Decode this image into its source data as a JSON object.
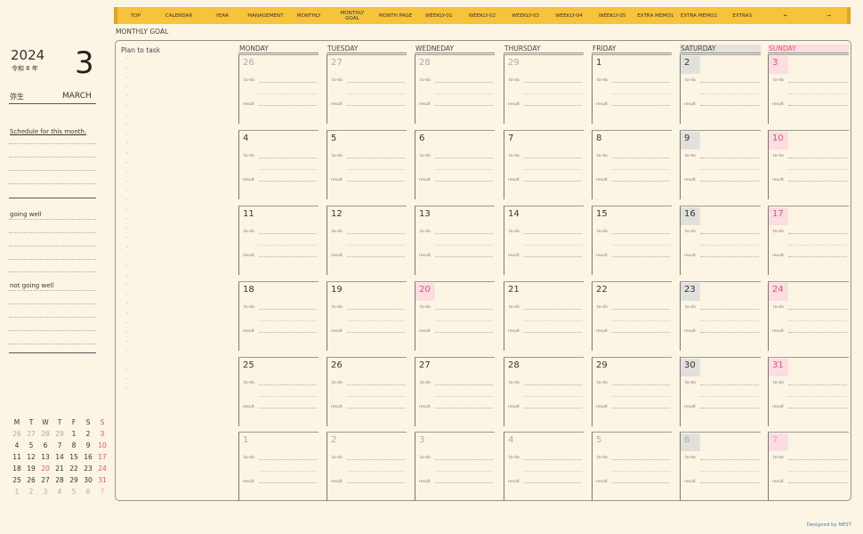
{
  "nav": {
    "tabs": [
      "TOP",
      "CALENDAR",
      "YEAR",
      "MANAGEMENT",
      "MONTHLY",
      "MONTHLY\nGOAL",
      "MONTH PAGE",
      "WEEKLY-01",
      "WEEKLY-02",
      "WEEKLY-03",
      "WEEKLY-04",
      "WEEKLY-05",
      "EXTRA MEMO1",
      "EXTRA MEMO2",
      "EXTRAS",
      "←",
      "→"
    ]
  },
  "header": {
    "monthly_goal": "MONTHLY GOAL",
    "plan_to_task": "Plan to task",
    "year": "2024",
    "era": "令和 6 年",
    "month_number": "3",
    "month_jp": "弥生",
    "month_en": "MARCH"
  },
  "sidebar": {
    "schedule_label": "Schedule for this month.",
    "going_well_label": "going well",
    "not_going_well_label": "not going well"
  },
  "calendar": {
    "weekdays": [
      "MONDAY",
      "TUESDAY",
      "WEDNEDAY",
      "THURSDAY",
      "FRIDAY",
      "SATURDAY",
      "SUNDAY"
    ],
    "todo_label": "to-do",
    "result_label": "result",
    "weeks": [
      [
        {
          "d": "26",
          "dim": true
        },
        {
          "d": "27",
          "dim": true
        },
        {
          "d": "28",
          "dim": true
        },
        {
          "d": "29",
          "dim": true
        },
        {
          "d": "1"
        },
        {
          "d": "2",
          "sat": true
        },
        {
          "d": "3",
          "hol": true
        }
      ],
      [
        {
          "d": "4"
        },
        {
          "d": "5"
        },
        {
          "d": "6"
        },
        {
          "d": "7"
        },
        {
          "d": "8"
        },
        {
          "d": "9",
          "sat": true
        },
        {
          "d": "10",
          "hol": true
        }
      ],
      [
        {
          "d": "11"
        },
        {
          "d": "12"
        },
        {
          "d": "13"
        },
        {
          "d": "14"
        },
        {
          "d": "15"
        },
        {
          "d": "16",
          "sat": true
        },
        {
          "d": "17",
          "hol": true
        }
      ],
      [
        {
          "d": "18"
        },
        {
          "d": "19"
        },
        {
          "d": "20",
          "hol": true
        },
        {
          "d": "21"
        },
        {
          "d": "22"
        },
        {
          "d": "23",
          "sat": true
        },
        {
          "d": "24",
          "hol": true
        }
      ],
      [
        {
          "d": "25"
        },
        {
          "d": "26"
        },
        {
          "d": "27"
        },
        {
          "d": "28"
        },
        {
          "d": "29"
        },
        {
          "d": "30",
          "sat": true
        },
        {
          "d": "31",
          "hol": true
        }
      ],
      [
        {
          "d": "1",
          "dim": true
        },
        {
          "d": "2",
          "dim": true
        },
        {
          "d": "3",
          "dim": true
        },
        {
          "d": "4",
          "dim": true
        },
        {
          "d": "5",
          "dim": true
        },
        {
          "d": "6",
          "dim": true,
          "sat": true
        },
        {
          "d": "7",
          "dim": true,
          "hol": true
        }
      ]
    ]
  },
  "mini_calendar": {
    "headers": [
      "M",
      "T",
      "W",
      "T",
      "F",
      "S",
      "S"
    ],
    "rows": [
      [
        "26",
        "27",
        "28",
        "29",
        "1",
        "2",
        "3"
      ],
      [
        "4",
        "5",
        "6",
        "7",
        "8",
        "9",
        "10"
      ],
      [
        "11",
        "12",
        "13",
        "14",
        "15",
        "16",
        "17"
      ],
      [
        "18",
        "19",
        "20",
        "21",
        "22",
        "23",
        "24"
      ],
      [
        "25",
        "26",
        "27",
        "28",
        "29",
        "30",
        "31"
      ],
      [
        "1",
        "2",
        "3",
        "4",
        "5",
        "6",
        "7"
      ]
    ]
  },
  "footer": {
    "credit": "Designed by NEST"
  },
  "colors": {
    "nav_bg": "#f6c33a",
    "page_bg": "#fdf5e4",
    "holiday": "#e5556e",
    "saturday_bg": "#e2e0db",
    "holiday_bg": "#fbdde2"
  }
}
